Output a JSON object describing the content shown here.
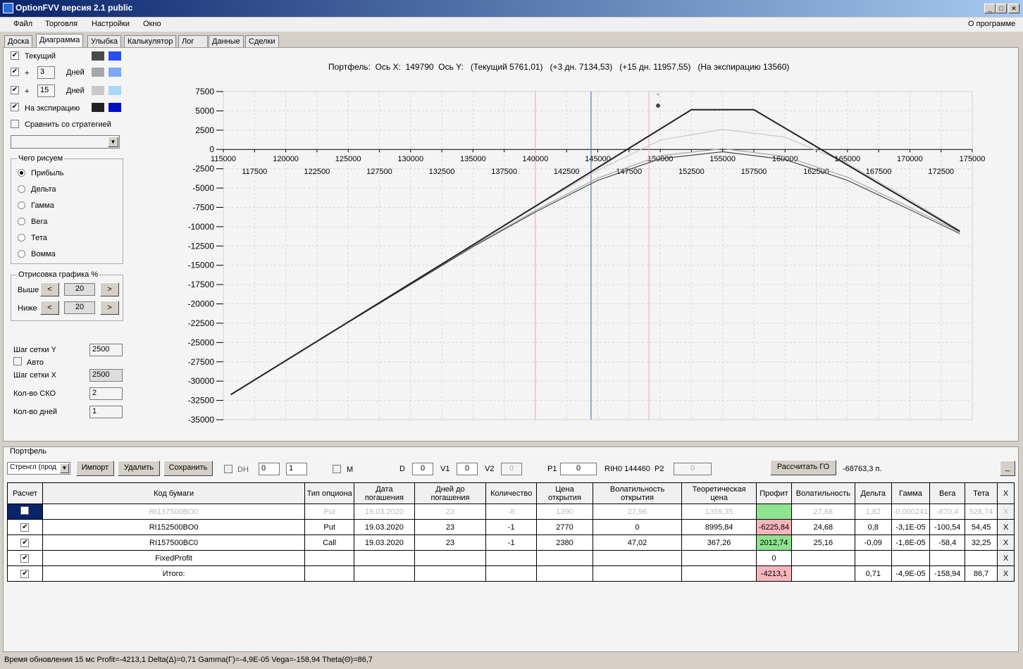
{
  "window": {
    "title": "OptionFVV версия 2.1 public"
  },
  "menu": [
    "Файл",
    "Торговля",
    "Настройки",
    "Окно"
  ],
  "about": "О программе",
  "tabs": [
    "Доска",
    "Диаграмма",
    "Улыбка",
    "Калькулятор",
    "Лог",
    "Данные",
    "Сделки"
  ],
  "left": {
    "current": "Текущий",
    "plus": "+",
    "days": "Дней",
    "days1": "3",
    "days2": "15",
    "expiration": "На экспирацию",
    "compare": "Сравнить со стратегией",
    "colors": {
      "current": [
        "#4a4a4a",
        "#2a4cf5"
      ],
      "d1": [
        "#a6a6a6",
        "#7aa8f5"
      ],
      "d2": [
        "#c8c8c8",
        "#a6d8f8"
      ],
      "exp": [
        "#222222",
        "#0010c0"
      ]
    },
    "what_title": "Чего рисуем",
    "what": [
      "Прибыль",
      "Дельта",
      "Гамма",
      "Вега",
      "Тета",
      "Вомма"
    ],
    "draw_title": "Отрисовка графика %",
    "above": "Выше",
    "below": "Ниже",
    "above_val": "20",
    "below_val": "20",
    "lt": "<",
    "gt": ">",
    "gridY": "Шаг сетки Y",
    "gridY_val": "2500",
    "auto": "Авто",
    "gridX": "Шаг сетки X",
    "gridX_val": "2500",
    "sko": "Кол-во СКО",
    "sko_val": "2",
    "ndays": "Кол-во дней",
    "ndays_val": "1"
  },
  "chart_data": {
    "type": "line",
    "title": "Портфель:  Ось X:  149790  Ось Y:   (Текущий 5761,01)   (+3 дн. 7134,53)   (+15 дн. 11957,55)   (На экспирацию 13560)",
    "xlim": [
      115000,
      175000
    ],
    "ylim": [
      -35000,
      7500
    ],
    "xticks_top": [
      115000,
      120000,
      125000,
      130000,
      135000,
      140000,
      145000,
      150000,
      155000,
      160000,
      165000,
      170000,
      175000
    ],
    "xticks_bottom": [
      117500,
      122500,
      127500,
      132500,
      137500,
      142500,
      147500,
      152500,
      157500,
      162500,
      167500,
      172500
    ],
    "yticks": [
      7500,
      5000,
      2500,
      0,
      -2500,
      -5000,
      -7500,
      -10000,
      -12500,
      -15000,
      -17500,
      -20000,
      -22500,
      -25000,
      -27500,
      -30000,
      -32500,
      -35000
    ],
    "vlines": {
      "price": 144460,
      "sigma": [
        140000,
        149100
      ]
    },
    "series": [
      {
        "name": "На экспирацию",
        "color": "#222222",
        "x": [
          115600,
          152500,
          157500,
          174000
        ],
        "y": [
          -31750,
          5150,
          5150,
          -10600
        ]
      },
      {
        "name": "Текущий",
        "color": "#4a4a4a",
        "x": [
          115600,
          125000,
          135000,
          140000,
          145000,
          150000,
          155000,
          160000,
          165000,
          170000,
          174000
        ],
        "y": [
          -31750,
          -22400,
          -12600,
          -8100,
          -4000,
          -1200,
          -300,
          -1300,
          -4000,
          -7800,
          -10900
        ]
      },
      {
        "name": "+3 дн.",
        "color": "#a6a6a6",
        "x": [
          115600,
          125000,
          135000,
          140000,
          145000,
          150000,
          155000,
          160000,
          165000,
          170000,
          174000
        ],
        "y": [
          -31750,
          -22400,
          -12500,
          -7900,
          -3700,
          -800,
          100,
          -900,
          -3600,
          -7500,
          -10700
        ]
      },
      {
        "name": "+15 дн.",
        "color": "#c8c8c8",
        "x": [
          115600,
          125000,
          135000,
          140000,
          145000,
          150000,
          155000,
          160000,
          165000,
          170000,
          174000
        ],
        "y": [
          -31750,
          -22350,
          -12350,
          -7400,
          -2700,
          1200,
          2600,
          1600,
          -1800,
          -6500,
          -10500
        ]
      }
    ]
  },
  "portfolio": {
    "title": "Портфель",
    "strategy": "Стренгл (прод",
    "import": "Импорт",
    "delete": "Удалить",
    "save": "Сохранить",
    "dh": "DH",
    "s1": "0",
    "s2": "1",
    "m": "M",
    "d": "D",
    "d_val": "0",
    "v1": "V1",
    "v1_val": "0",
    "v2": "V2",
    "v2_val": "0",
    "p1": "P1",
    "p1_val": "0",
    "fut": "RIH0 144460",
    "p2": "P2",
    "p2_val": "0",
    "calc_go": "Рассчитать ГО",
    "go_val": "-68763,3 п.",
    "min": "_",
    "headers": [
      "Расчет",
      "Код бумаги",
      "Тип опциона",
      "Дата погашения",
      "Дней до погашения",
      "Количество",
      "Цена открытия",
      "Волатильность открытия",
      "Теоретическая цена",
      "Профит",
      "Волатильность",
      "Дельта",
      "Гамма",
      "Вега",
      "Тета",
      "X"
    ],
    "rows": [
      {
        "checked": false,
        "dis": true,
        "cells": [
          "RI137500BO0",
          "Put",
          "19.03.2020",
          "23",
          "-8",
          "1390",
          "27,96",
          "1359,35",
          "",
          "27,68",
          "1,82",
          "-0,000241",
          "-870,4",
          "528,74"
        ],
        "pc": "grn"
      },
      {
        "checked": true,
        "cells": [
          "RI152500BO0",
          "Put",
          "19.03.2020",
          "23",
          "-1",
          "2770",
          "0",
          "8995,84",
          "-6225,84",
          "24,68",
          "0,8",
          "-3,1E-05",
          "-100,54",
          "54,45"
        ],
        "pc": "red"
      },
      {
        "checked": true,
        "cells": [
          "RI157500BC0",
          "Call",
          "19.03.2020",
          "23",
          "-1",
          "2380",
          "47,02",
          "367,26",
          "2012,74",
          "25,16",
          "-0,09",
          "-1,8E-05",
          "-58,4",
          "32,25"
        ],
        "pc": "grn"
      },
      {
        "checked": true,
        "cells": [
          "FixedProfit",
          "",
          "",
          "",
          "",
          "",
          "",
          "",
          "0",
          "",
          "",
          "",
          "",
          ""
        ],
        "pc": ""
      },
      {
        "checked": true,
        "cells": [
          "Итого:",
          "",
          "",
          "",
          "",
          "",
          "",
          "",
          "-4213,1",
          "",
          "0,71",
          "-4,9E-05",
          "-158,94",
          "86,7"
        ],
        "pc": "red"
      }
    ],
    "x": "X"
  },
  "status": "Время обновления 15 мс  Profit=-4213,1 Delta(Δ)=0,71 Gamma(Γ)=-4,9E-05 Vega=-158,94 Theta(Θ)=86,7"
}
